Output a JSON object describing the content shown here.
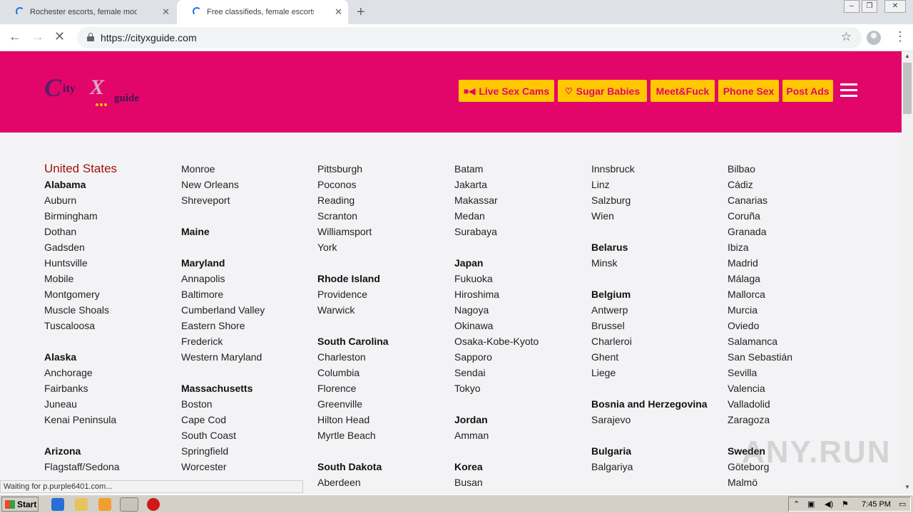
{
  "browser": {
    "tabs": [
      {
        "title": "Rochester escorts, female models, ir",
        "loading": true
      },
      {
        "title": "Free classifieds, female escorts, fem",
        "loading": true,
        "active": true
      }
    ],
    "new_tab": "+",
    "url": "https://cityxguide.com",
    "status": "Waiting for p.purple6401.com..."
  },
  "site": {
    "logo_text": {
      "c": "C",
      "city": "ity",
      "x": "X",
      "guide": "guide"
    },
    "nav": [
      {
        "label": "Live Sex Cams",
        "icon": "video-icon"
      },
      {
        "label": "Sugar Babies",
        "icon": "sugar-icon"
      },
      {
        "label": "Meet&Fuck"
      },
      {
        "label": "Phone Sex"
      },
      {
        "label": "Post Ads"
      }
    ],
    "colors": {
      "header": "#e3066a",
      "button": "#ffc801",
      "country": "#a01010"
    }
  },
  "columns": [
    [
      {
        "t": "United States",
        "k": "country"
      },
      {
        "t": "Alabama",
        "k": "state"
      },
      {
        "t": "Auburn"
      },
      {
        "t": "Birmingham"
      },
      {
        "t": "Dothan"
      },
      {
        "t": "Gadsden"
      },
      {
        "t": "Huntsville"
      },
      {
        "t": "Mobile"
      },
      {
        "t": "Montgomery"
      },
      {
        "t": "Muscle Shoals"
      },
      {
        "t": "Tuscaloosa"
      },
      {
        "t": "",
        "k": "blank"
      },
      {
        "t": "Alaska",
        "k": "state"
      },
      {
        "t": "Anchorage"
      },
      {
        "t": "Fairbanks"
      },
      {
        "t": "Juneau"
      },
      {
        "t": "Kenai Peninsula"
      },
      {
        "t": "",
        "k": "blank"
      },
      {
        "t": "Arizona",
        "k": "state"
      },
      {
        "t": "Flagstaff/Sedona"
      }
    ],
    [
      {
        "t": "Monroe"
      },
      {
        "t": "New Orleans"
      },
      {
        "t": "Shreveport"
      },
      {
        "t": "",
        "k": "blank"
      },
      {
        "t": "Maine",
        "k": "state"
      },
      {
        "t": "",
        "k": "blank"
      },
      {
        "t": "Maryland",
        "k": "state"
      },
      {
        "t": "Annapolis"
      },
      {
        "t": "Baltimore"
      },
      {
        "t": "Cumberland Valley"
      },
      {
        "t": "Eastern Shore"
      },
      {
        "t": "Frederick"
      },
      {
        "t": "Western Maryland"
      },
      {
        "t": "",
        "k": "blank"
      },
      {
        "t": "Massachusetts",
        "k": "state"
      },
      {
        "t": "Boston"
      },
      {
        "t": "Cape Cod"
      },
      {
        "t": "South Coast"
      },
      {
        "t": "Springfield"
      },
      {
        "t": "Worcester"
      }
    ],
    [
      {
        "t": "Pittsburgh"
      },
      {
        "t": "Poconos"
      },
      {
        "t": "Reading"
      },
      {
        "t": "Scranton"
      },
      {
        "t": "Williamsport"
      },
      {
        "t": "York"
      },
      {
        "t": "",
        "k": "blank"
      },
      {
        "t": "Rhode Island",
        "k": "state"
      },
      {
        "t": "Providence"
      },
      {
        "t": "Warwick"
      },
      {
        "t": "",
        "k": "blank"
      },
      {
        "t": "South Carolina",
        "k": "state"
      },
      {
        "t": "Charleston"
      },
      {
        "t": "Columbia"
      },
      {
        "t": "Florence"
      },
      {
        "t": "Greenville"
      },
      {
        "t": "Hilton Head"
      },
      {
        "t": "Myrtle Beach"
      },
      {
        "t": "",
        "k": "blank"
      },
      {
        "t": "South Dakota",
        "k": "state"
      },
      {
        "t": "Aberdeen"
      }
    ],
    [
      {
        "t": "Batam"
      },
      {
        "t": "Jakarta"
      },
      {
        "t": "Makassar"
      },
      {
        "t": "Medan"
      },
      {
        "t": "Surabaya"
      },
      {
        "t": "",
        "k": "blank"
      },
      {
        "t": "Japan",
        "k": "state"
      },
      {
        "t": "Fukuoka"
      },
      {
        "t": "Hiroshima"
      },
      {
        "t": "Nagoya"
      },
      {
        "t": "Okinawa"
      },
      {
        "t": "Osaka-Kobe-Kyoto"
      },
      {
        "t": "Sapporo"
      },
      {
        "t": "Sendai"
      },
      {
        "t": "Tokyo"
      },
      {
        "t": "",
        "k": "blank"
      },
      {
        "t": "Jordan",
        "k": "state"
      },
      {
        "t": "Amman"
      },
      {
        "t": "",
        "k": "blank"
      },
      {
        "t": "Korea",
        "k": "state"
      },
      {
        "t": "Busan"
      }
    ],
    [
      {
        "t": "Innsbruck"
      },
      {
        "t": "Linz"
      },
      {
        "t": "Salzburg"
      },
      {
        "t": "Wien"
      },
      {
        "t": "",
        "k": "blank"
      },
      {
        "t": "Belarus",
        "k": "state"
      },
      {
        "t": "Minsk"
      },
      {
        "t": "",
        "k": "blank"
      },
      {
        "t": "Belgium",
        "k": "state"
      },
      {
        "t": "Antwerp"
      },
      {
        "t": "Brussel"
      },
      {
        "t": "Charleroi"
      },
      {
        "t": "Ghent"
      },
      {
        "t": "Liege"
      },
      {
        "t": "",
        "k": "blank"
      },
      {
        "t": "Bosnia and Herzegovina",
        "k": "state"
      },
      {
        "t": "Sarajevo"
      },
      {
        "t": "",
        "k": "blank"
      },
      {
        "t": "Bulgaria",
        "k": "state"
      },
      {
        "t": "Balgariya"
      }
    ],
    [
      {
        "t": "Bilbao"
      },
      {
        "t": "Cádiz"
      },
      {
        "t": "Canarias"
      },
      {
        "t": "Coruña"
      },
      {
        "t": "Granada"
      },
      {
        "t": "Ibiza"
      },
      {
        "t": "Madrid"
      },
      {
        "t": "Málaga"
      },
      {
        "t": "Mallorca"
      },
      {
        "t": "Murcia"
      },
      {
        "t": "Oviedo"
      },
      {
        "t": "Salamanca"
      },
      {
        "t": "San Sebastián"
      },
      {
        "t": "Sevilla"
      },
      {
        "t": "Valencia"
      },
      {
        "t": "Valladolid"
      },
      {
        "t": "Zaragoza"
      },
      {
        "t": "",
        "k": "blank"
      },
      {
        "t": "Sweden",
        "k": "state"
      },
      {
        "t": "Göteborg"
      },
      {
        "t": "Malmö"
      }
    ]
  ],
  "watermark": "ANY.RUN",
  "taskbar": {
    "start": "Start",
    "time": "7:45 PM"
  }
}
